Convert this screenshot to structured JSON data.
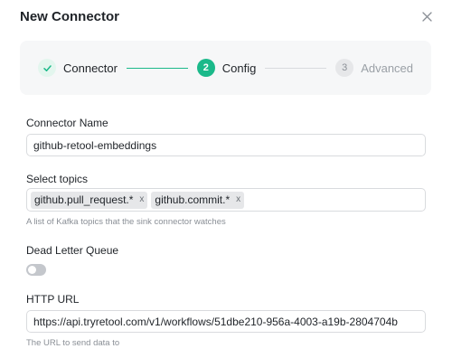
{
  "dialog": {
    "title": "New Connector"
  },
  "stepper": {
    "steps": [
      {
        "label": "Connector",
        "state": "done"
      },
      {
        "number": "2",
        "label": "Config",
        "state": "active"
      },
      {
        "number": "3",
        "label": "Advanced",
        "state": "upcoming"
      }
    ]
  },
  "form": {
    "connector_name": {
      "label": "Connector Name",
      "value": "github-retool-embeddings"
    },
    "topics": {
      "label": "Select topics",
      "tags": [
        "github.pull_request.*",
        "github.commit.*"
      ],
      "remove_glyph": "x",
      "helper": "A list of Kafka topics that the sink connector watches"
    },
    "dead_letter_queue": {
      "label": "Dead Letter Queue",
      "enabled": false
    },
    "http_url": {
      "label": "HTTP URL",
      "value": "https://api.tryretool.com/v1/workflows/51dbe210-956a-4003-a19b-2804704b",
      "helper": "The URL to send data to"
    }
  },
  "colors": {
    "accent": "#1bb98a",
    "toggle_off": "#c4c7cc"
  },
  "icons": {
    "close": "close-icon",
    "check": "check-icon"
  }
}
